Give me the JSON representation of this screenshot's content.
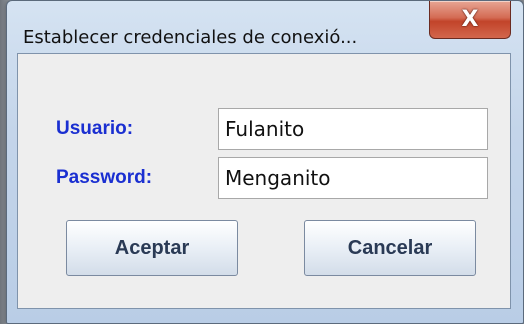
{
  "window": {
    "title": "Establecer credenciales de conexió...",
    "close_glyph": "X"
  },
  "form": {
    "user_label": "Usuario:",
    "user_value": "Fulanito",
    "password_label": "Password:",
    "password_value": "Menganito"
  },
  "buttons": {
    "accept_label": "Aceptar",
    "cancel_label": "Cancelar"
  },
  "colors": {
    "label": "#1a2fd1",
    "close_button": "#c2442a"
  }
}
